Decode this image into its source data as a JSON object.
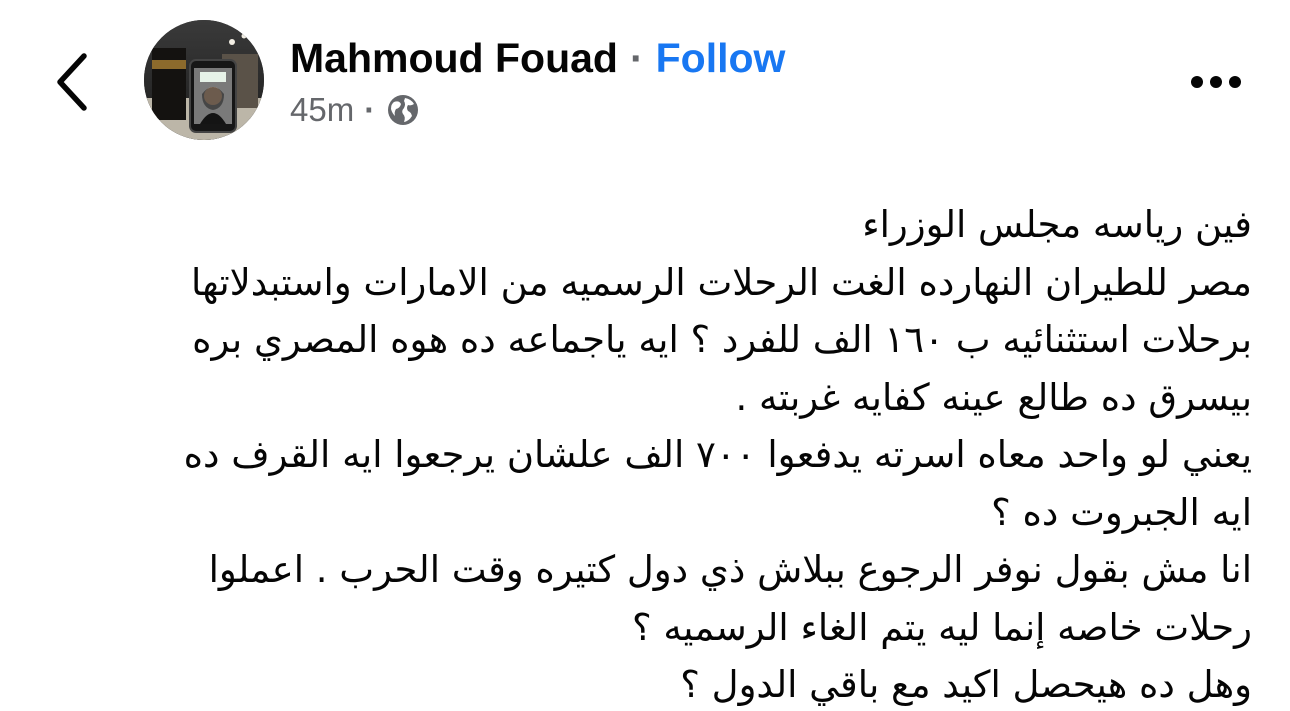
{
  "header": {
    "back_icon": "chevron-left-icon",
    "author_name": "Mahmoud Fouad",
    "separator": "·",
    "follow_label": "Follow",
    "timestamp": "45m",
    "meta_separator": "·",
    "audience_icon": "globe-icon",
    "more_icon": "more-horizontal-icon"
  },
  "colors": {
    "link": "#1877f2",
    "secondary_text": "#65676b",
    "primary_text": "#050505"
  },
  "post": {
    "lines": [
      "فين رياسه مجلس الوزراء",
      "مصر للطيران النهارده الغت الرحلات الرسميه من الامارات واستبدلاتها",
      "برحلات استثنائيه ب ١٦٠ الف للفرد ؟ ايه ياجماعه ده هوه المصري بره",
      "بيسرق ده طالع عينه كفايه غربته .",
      "يعني لو واحد معاه اسرته يدفعوا ٧٠٠ الف علشان يرجعوا  ايه القرف ده",
      "ايه الجبروت ده ؟",
      "انا مش بقول نوفر الرجوع ببلاش ذي دول كتيره وقت الحرب . اعملوا",
      "رحلات خاصه إنما ليه يتم الغاء الرسميه  ؟",
      "وهل ده هيحصل اكيد مع باقي الدول  ؟"
    ]
  }
}
